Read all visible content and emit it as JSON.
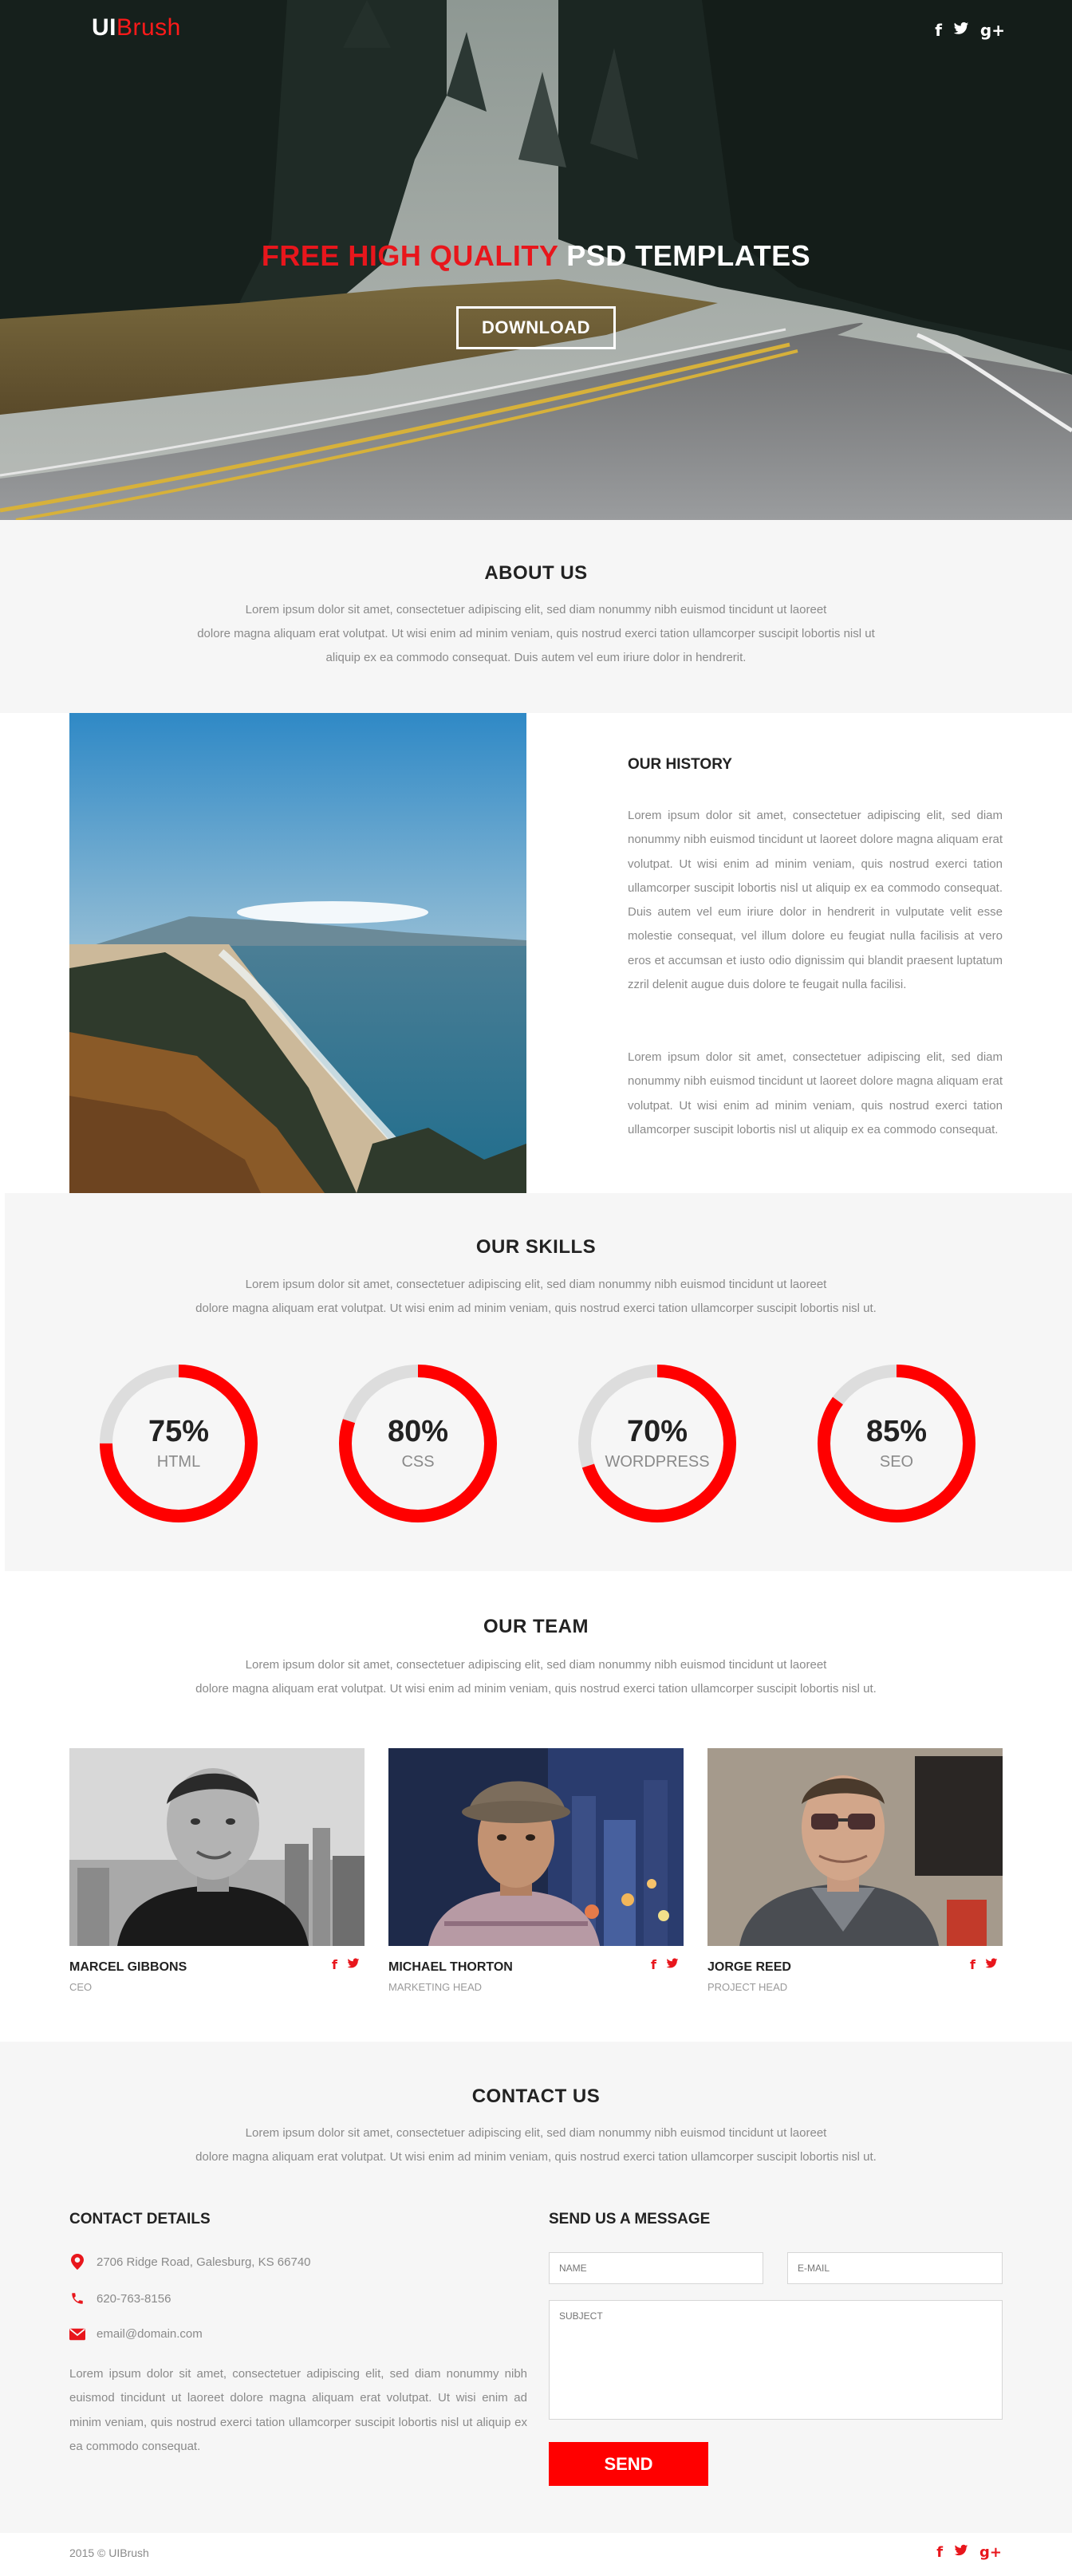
{
  "brand": {
    "logo_part1": "UI",
    "logo_part2": "Brush"
  },
  "header": {
    "social_icons": [
      "facebook-icon",
      "twitter-icon",
      "google-plus-icon"
    ]
  },
  "hero": {
    "title_accent": "FREE HIGH QUALITY",
    "title_rest": " PSD TEMPLATES",
    "button_label": "DOWNLOAD"
  },
  "about": {
    "title": "ABOUT US",
    "lines": [
      "Lorem ipsum dolor sit amet, consectetuer adipiscing elit, sed diam nonummy nibh euismod tincidunt ut laoreet",
      "dolore magna aliquam erat volutpat. Ut wisi enim ad minim veniam, quis nostrud exerci tation ullamcorper suscipit lobortis nisl ut",
      "aliquip ex ea commodo consequat. Duis autem vel eum iriure dolor in hendrerit."
    ]
  },
  "history": {
    "title": "OUR HISTORY",
    "paragraph1": "Lorem ipsum dolor sit amet, consectetuer adipiscing elit, sed diam nonummy nibh euismod tincidunt ut laoreet dolore magna aliquam erat volutpat. Ut wisi enim ad minim veniam, quis nostrud exerci tation ullamcorper suscipit lobortis nisl ut aliquip ex ea commodo consequat. Duis autem vel eum iriure dolor in hendrerit in vulputate velit esse molestie consequat, vel illum dolore eu feugiat nulla facilisis at vero eros et accumsan et iusto odio dignissim qui blandit praesent luptatum zzril delenit augue duis dolore te feugait nulla facilisi.",
    "paragraph2": "Lorem ipsum dolor sit amet, consectetuer adipiscing elit, sed diam nonummy nibh euismod tincidunt ut laoreet dolore magna aliquam erat volutpat. Ut wisi enim ad minim veniam, quis nostrud exerci tation ullamcorper suscipit lobortis nisl ut aliquip ex ea commodo consequat."
  },
  "skills": {
    "title": "OUR SKILLS",
    "lines": [
      "Lorem ipsum dolor sit amet, consectetuer adipiscing elit, sed diam nonummy nibh euismod tincidunt ut laoreet",
      "dolore magna aliquam erat volutpat. Ut wisi enim ad minim veniam, quis nostrud exerci tation ullamcorper suscipit lobortis nisl ut."
    ],
    "items": [
      {
        "percent_text": "75%",
        "percent": 75,
        "label": "HTML"
      },
      {
        "percent_text": "80%",
        "percent": 80,
        "label": "CSS"
      },
      {
        "percent_text": "70%",
        "percent": 70,
        "label": "WORDPRESS"
      },
      {
        "percent_text": "85%",
        "percent": 85,
        "label": "SEO"
      }
    ],
    "ring_color": "#ff0000",
    "track_color": "#dddddd"
  },
  "team": {
    "title": "OUR TEAM",
    "lines": [
      "Lorem ipsum dolor sit amet, consectetuer adipiscing elit, sed diam nonummy nibh euismod tincidunt ut laoreet",
      "dolore magna aliquam erat volutpat. Ut wisi enim ad minim veniam, quis nostrud exerci tation ullamcorper suscipit lobortis nisl ut."
    ],
    "members": [
      {
        "name": "MARCEL GIBBONS",
        "role": "CEO"
      },
      {
        "name": "MICHAEL THORTON",
        "role": "MARKETING HEAD"
      },
      {
        "name": "JORGE REED",
        "role": "PROJECT HEAD"
      }
    ]
  },
  "contact": {
    "title": "CONTACT US",
    "lines": [
      "Lorem ipsum dolor sit amet, consectetuer adipiscing elit, sed diam nonummy nibh euismod tincidunt ut laoreet",
      "dolore magna aliquam erat volutpat. Ut wisi enim ad minim veniam, quis nostrud exerci tation ullamcorper suscipit lobortis nisl ut."
    ],
    "details_title": "CONTACT DETAILS",
    "address": "2706 Ridge Road, Galesburg, KS 66740",
    "phone": "620-763-8156",
    "email": "email@domain.com",
    "details_text": "Lorem ipsum dolor sit amet, consectetuer adipiscing elit, sed diam nonummy nibh euismod tincidunt ut laoreet dolore magna aliquam erat volutpat. Ut wisi enim ad minim veniam, quis nostrud exerci tation ullamcorper suscipit lobortis nisl ut aliquip ex ea commodo consequat.",
    "message_title": "SEND US A MESSAGE",
    "name_placeholder": "NAME",
    "email_placeholder": "E-MAIL",
    "subject_placeholder": "SUBJECT",
    "send_label": "SEND"
  },
  "footer": {
    "copyright": "2015 © UIBrush",
    "social_icons": [
      "facebook-icon",
      "twitter-icon",
      "google-plus-icon"
    ]
  },
  "colors": {
    "accent": "#e8161c",
    "section_bg": "#f6f6f6",
    "muted_text": "#8a8a8a"
  }
}
